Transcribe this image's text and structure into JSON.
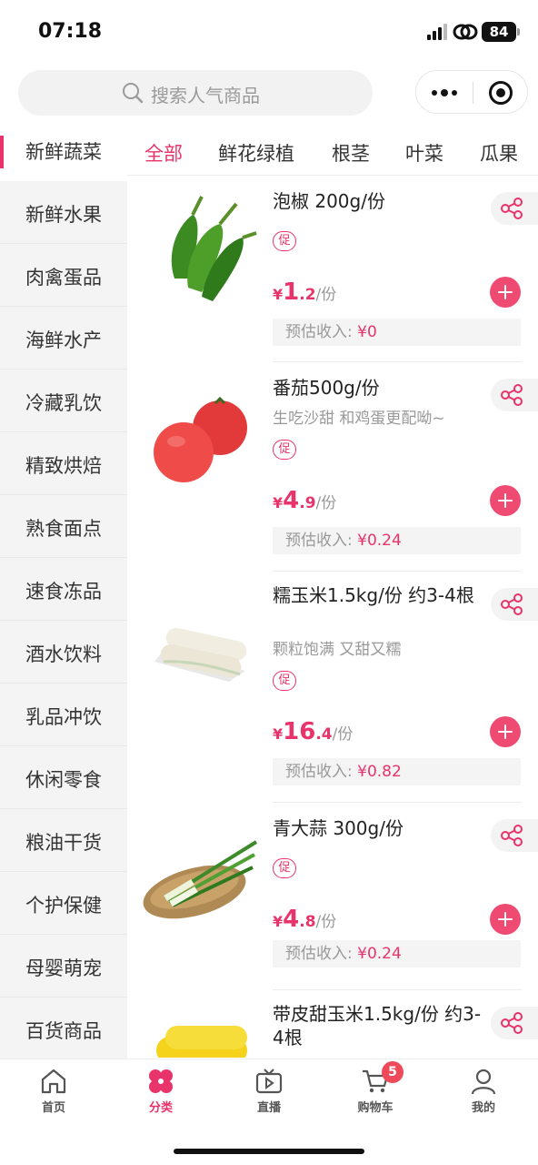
{
  "status_bar": {
    "time": "07:18",
    "battery": "84"
  },
  "header": {
    "search_placeholder": "搜索人气商品",
    "more_icon": "more-dots-icon",
    "close_icon": "target-icon"
  },
  "sidebar": {
    "categories": [
      "新鲜蔬菜",
      "新鲜水果",
      "肉禽蛋品",
      "海鲜水产",
      "冷藏乳饮",
      "精致烘焙",
      "熟食面点",
      "速食冻品",
      "酒水饮料",
      "乳品冲饮",
      "休闲零食",
      "粮油干货",
      "个护保健",
      "母婴萌宠",
      "百货商品"
    ],
    "active": "新鲜蔬菜"
  },
  "tabs": {
    "items": [
      "全部",
      "鲜花绿植",
      "根茎",
      "叶菜",
      "瓜果"
    ],
    "active": "全部"
  },
  "products": [
    {
      "name": "泡椒 200g/份",
      "desc": "",
      "promo": "促",
      "currency": "¥",
      "price_int": "1",
      "price_dec": ".2",
      "unit": "/份",
      "income_label": "预估收入: ",
      "income_value": "¥0"
    },
    {
      "name": "番茄500g/份",
      "desc": "生吃沙甜 和鸡蛋更配呦~",
      "promo": "促",
      "currency": "¥",
      "price_int": "4",
      "price_dec": ".9",
      "unit": "/份",
      "income_label": "预估收入: ",
      "income_value": "¥0.24"
    },
    {
      "name": "糯玉米1.5kg/份 约3-4根",
      "desc": "颗粒饱满 又甜又糯",
      "promo": "促",
      "currency": "¥",
      "price_int": "16",
      "price_dec": ".4",
      "unit": "/份",
      "income_label": "预估收入: ",
      "income_value": "¥0.82"
    },
    {
      "name": "青大蒜 300g/份",
      "desc": "",
      "promo": "促",
      "currency": "¥",
      "price_int": "4",
      "price_dec": ".8",
      "unit": "/份",
      "income_label": "预估收入: ",
      "income_value": "¥0.24"
    },
    {
      "name": "带皮甜玉米1.5kg/份 约3-4根",
      "desc": ""
    }
  ],
  "bottom_nav": {
    "items": [
      "首页",
      "分类",
      "直播",
      "购物车",
      "我的"
    ],
    "active": "分类",
    "cart_badge": "5"
  },
  "colors": {
    "accent": "#e8336b",
    "add_button": "#ef4a72"
  }
}
